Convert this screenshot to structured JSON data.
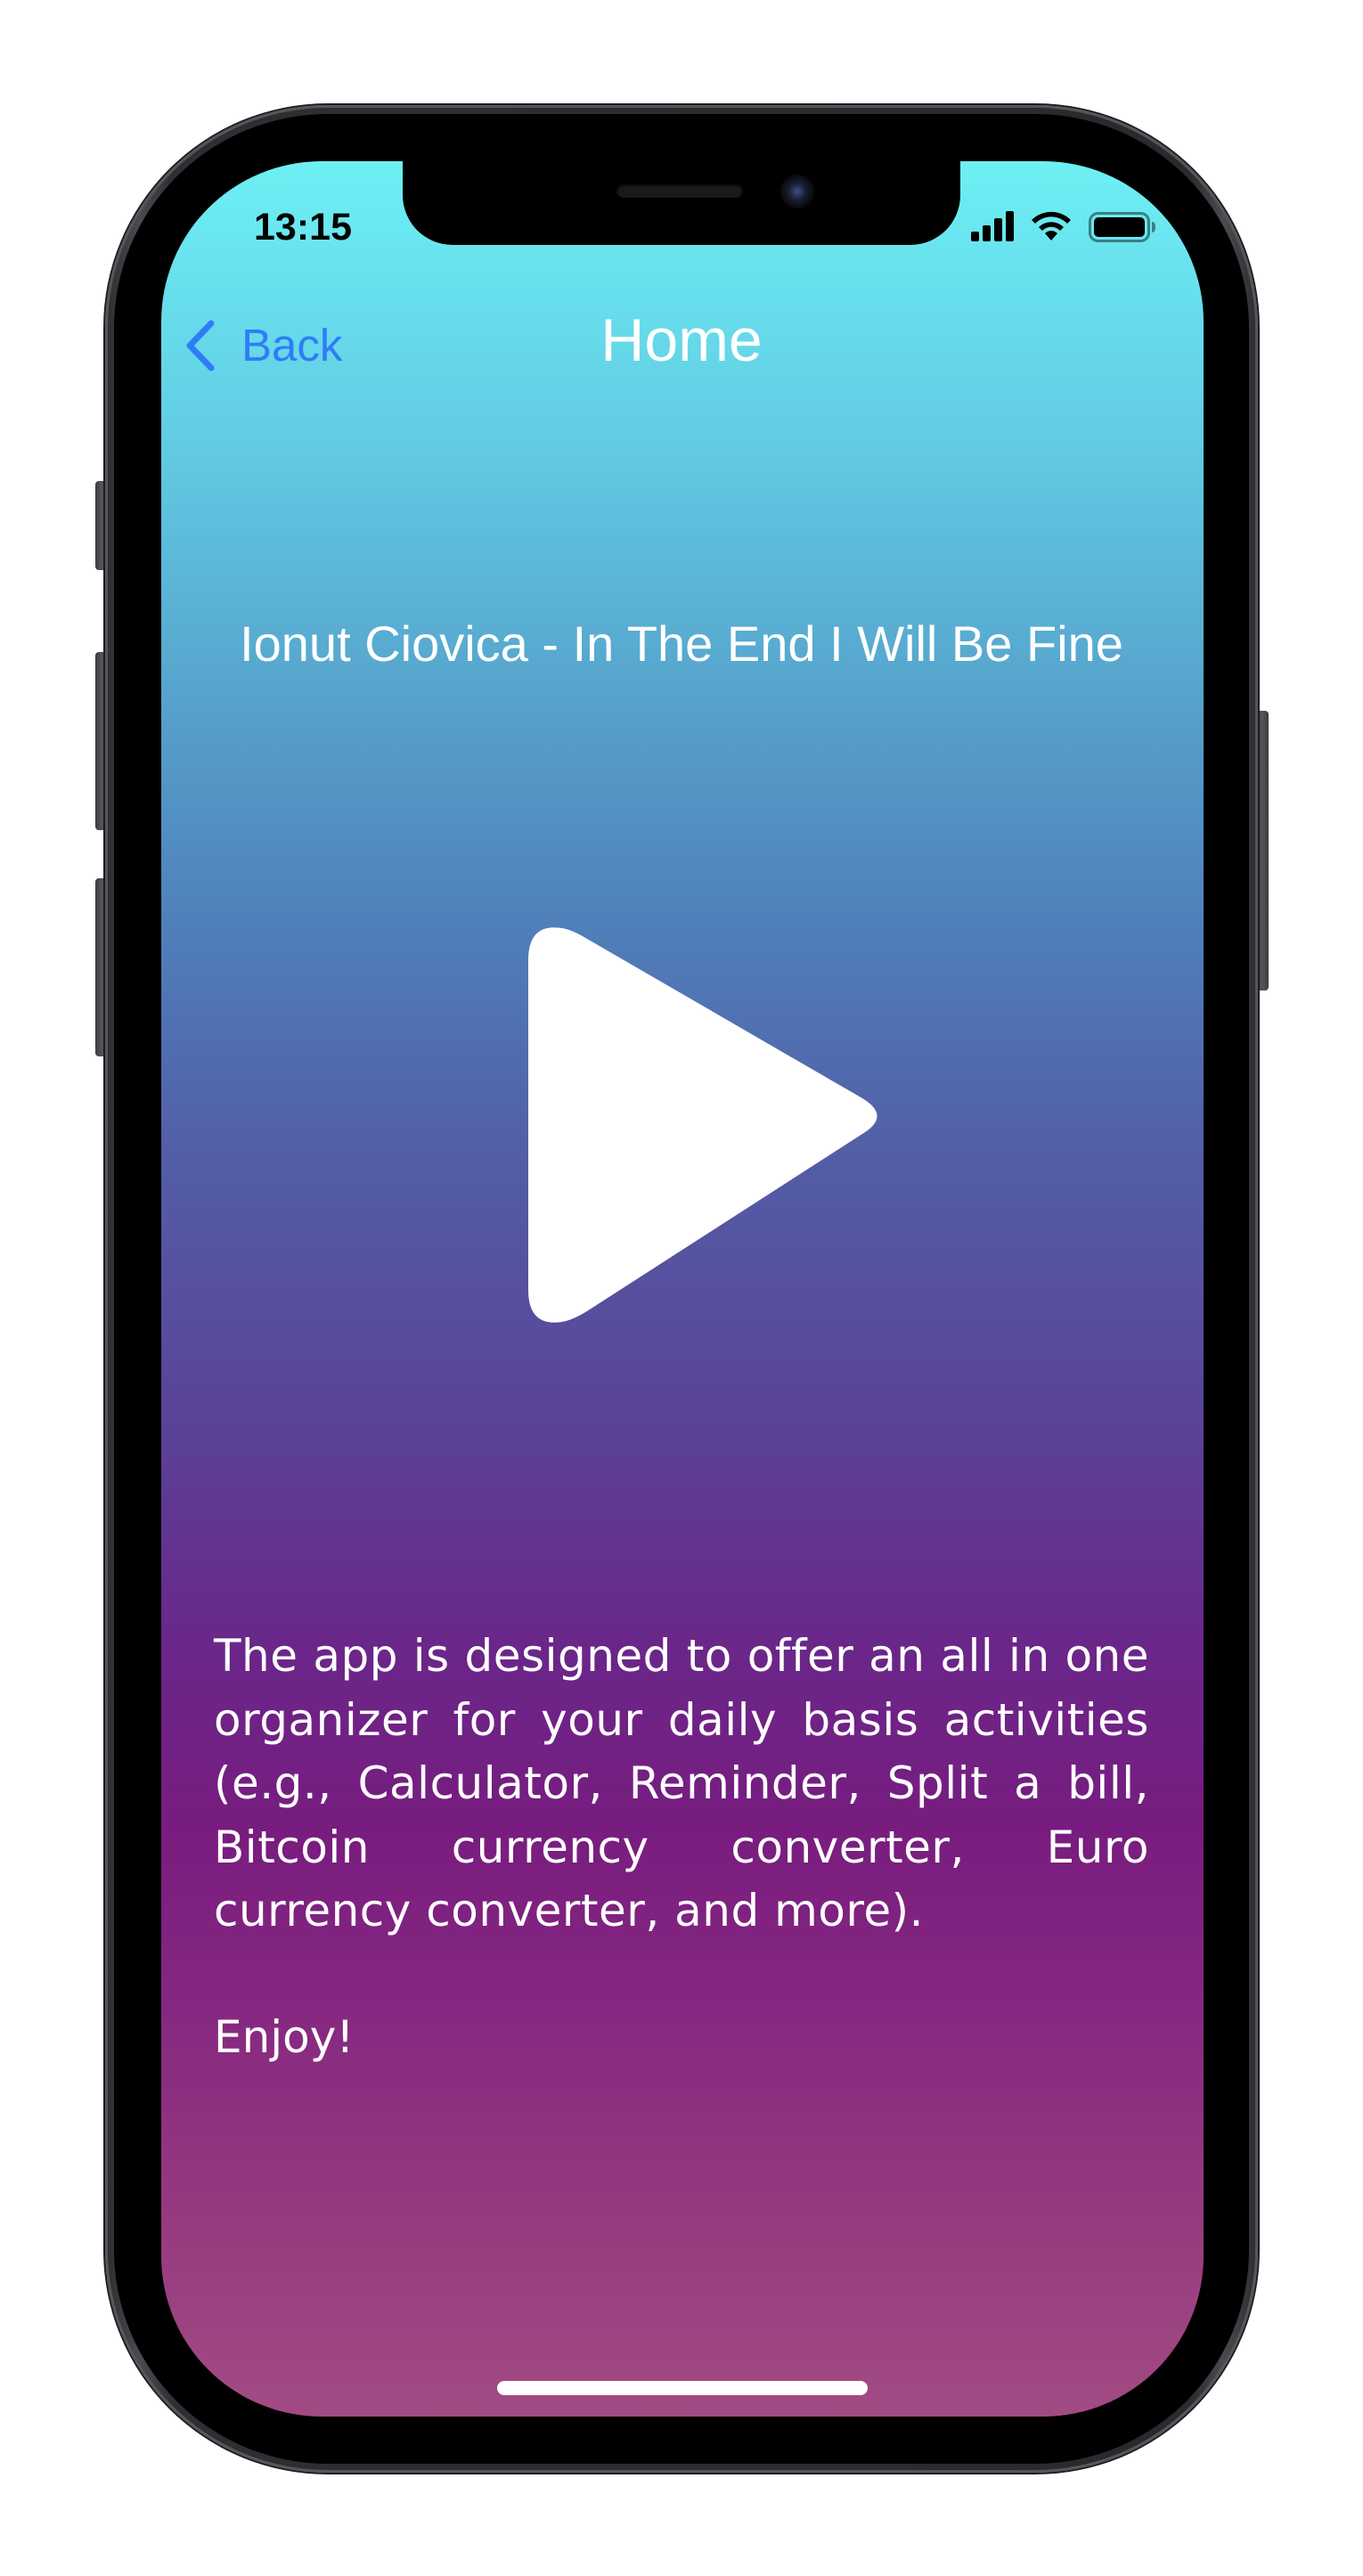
{
  "status_bar": {
    "time": "13:15",
    "signal_icon": "cellular-signal-icon",
    "wifi_icon": "wifi-icon",
    "battery_icon": "battery-full-icon"
  },
  "nav_bar": {
    "back_label": "Back",
    "back_icon": "chevron-left-icon",
    "title": "Home",
    "back_color": "#2f7df6"
  },
  "main": {
    "song_title": "Ionut Ciovica - In The End I Will Be Fine",
    "play_icon": "play-icon",
    "description": "The app is designed to offer an all in one organizer for your daily basis activities (e.g., Calculator, Reminder, Split a bill, Bitcoin currency converter, Euro currency converter, and more).",
    "closing": "Enjoy!"
  },
  "theme": {
    "gradient_top": "#6df0f4",
    "gradient_middle": "#5a4298",
    "gradient_bottom": "#a24b83",
    "text_color": "#ffffff"
  }
}
